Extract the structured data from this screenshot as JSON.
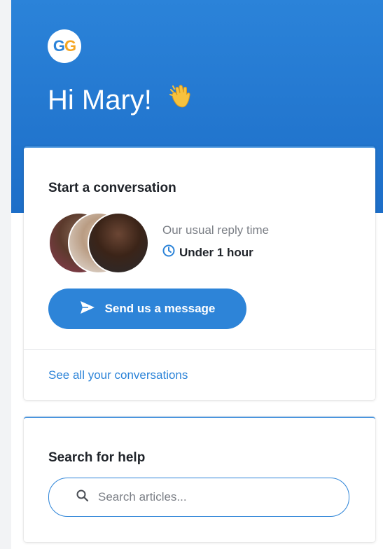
{
  "header": {
    "logo_text_1": "G",
    "logo_text_2": "G",
    "greeting": "Hi Mary!",
    "greeting_emoji": "waving-hand-icon"
  },
  "conversation_card": {
    "title": "Start a conversation",
    "reply_label": "Our usual reply time",
    "reply_time": "Under 1 hour",
    "send_button_label": "Send us a message",
    "see_all_link": "See all your conversations"
  },
  "search_card": {
    "title": "Search for help",
    "search_placeholder": "Search articles..."
  },
  "colors": {
    "header_blue": "#2b83d9",
    "accent": "#2d84d8",
    "logo_orange": "#f5a623"
  }
}
